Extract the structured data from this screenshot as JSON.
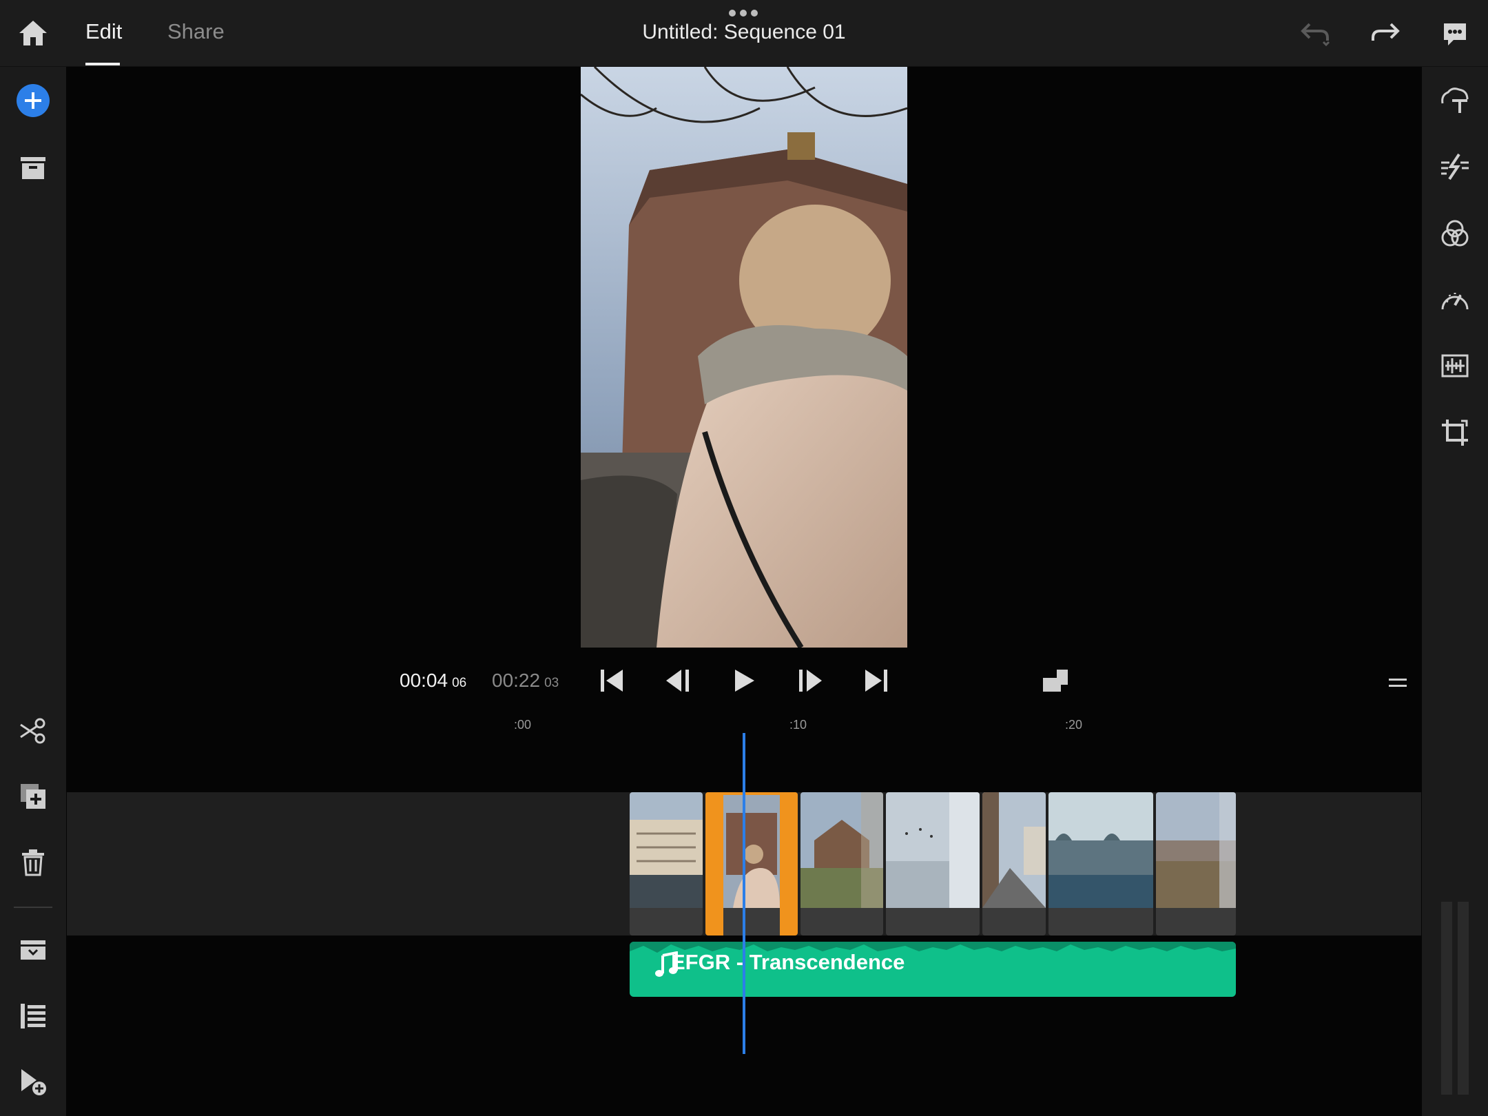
{
  "header": {
    "tabs": [
      {
        "label": "Edit",
        "active": true
      },
      {
        "label": "Share",
        "active": false
      }
    ],
    "title": "Untitled: Sequence 01",
    "more_icon": "more-dots-icon",
    "home_icon": "home-icon",
    "undo_icon": "undo-icon",
    "redo_icon": "redo-icon",
    "feedback_icon": "feedback-icon"
  },
  "left_toolbar": {
    "top": [
      "add-media-icon",
      "project-media-icon"
    ],
    "bottom": [
      "split-icon",
      "duplicate-icon",
      "delete-icon",
      "media-bin-icon",
      "track-list-icon",
      "add-effect-icon"
    ]
  },
  "right_toolbar": [
    "titles-icon",
    "transitions-icon",
    "color-icon",
    "speed-icon",
    "audio-icon",
    "transform-icon"
  ],
  "playback": {
    "current_time": "00:04",
    "current_frames": "06",
    "total_time": "00:22",
    "total_frames": "03",
    "controls": [
      "skip-to-start-icon",
      "step-back-icon",
      "play-icon",
      "step-forward-icon",
      "skip-to-end-icon"
    ],
    "aspect_icon": "aspect-ratio-icon",
    "menu_icon": "timeline-menu-icon"
  },
  "timeline": {
    "ruler_labels": [
      ":00",
      ":10",
      ":20"
    ],
    "clips": [
      {
        "name": "clip-canal-buildings",
        "selected": false
      },
      {
        "name": "clip-woman-tower",
        "selected": true
      },
      {
        "name": "clip-fortress",
        "selected": false
      },
      {
        "name": "clip-sky-birds",
        "selected": false
      },
      {
        "name": "clip-street",
        "selected": false
      },
      {
        "name": "clip-waterfront",
        "selected": false
      },
      {
        "name": "clip-city-view",
        "selected": false
      }
    ],
    "music_track": "EFGR - Transcendence"
  },
  "colors": {
    "accent_blue": "#2c7fe8",
    "selection_orange": "#f0931d",
    "music_green": "#0fc08a"
  }
}
